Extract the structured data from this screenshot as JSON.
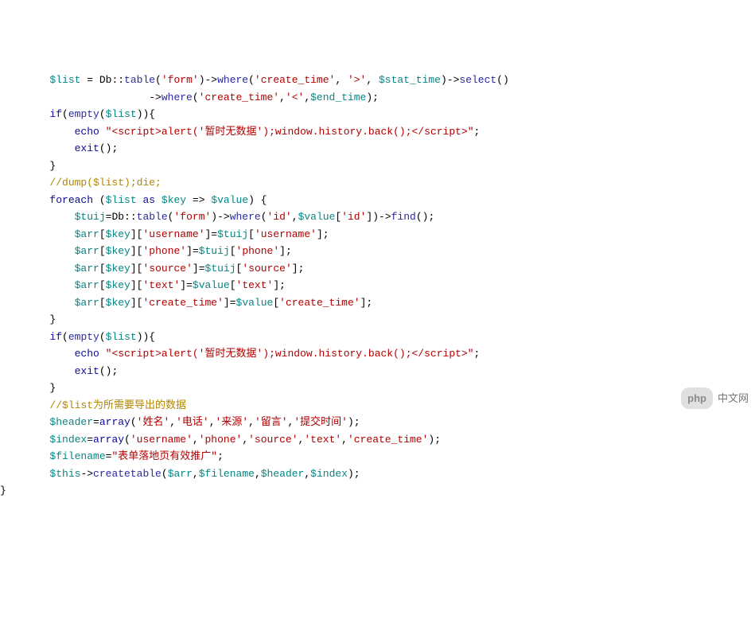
{
  "lines": [
    {
      "indent": 8,
      "tokens": [
        {
          "t": "v",
          "x": "$list"
        },
        {
          "t": "p",
          "x": " = Db::"
        },
        {
          "t": "f",
          "x": "table"
        },
        {
          "t": "p",
          "x": "("
        },
        {
          "t": "s",
          "x": "'form'"
        },
        {
          "t": "p",
          "x": ")->"
        },
        {
          "t": "f",
          "x": "where"
        },
        {
          "t": "p",
          "x": "("
        },
        {
          "t": "s",
          "x": "'create_time'"
        },
        {
          "t": "p",
          "x": ", "
        },
        {
          "t": "s",
          "x": "'>'"
        },
        {
          "t": "p",
          "x": ", "
        },
        {
          "t": "v",
          "x": "$stat_time"
        },
        {
          "t": "p",
          "x": ")->"
        },
        {
          "t": "f",
          "x": "select"
        },
        {
          "t": "p",
          "x": "()"
        }
      ]
    },
    {
      "indent": 24,
      "tokens": [
        {
          "t": "p",
          "x": "->"
        },
        {
          "t": "f",
          "x": "where"
        },
        {
          "t": "p",
          "x": "("
        },
        {
          "t": "s",
          "x": "'create_time'"
        },
        {
          "t": "p",
          "x": ","
        },
        {
          "t": "s",
          "x": "'<'"
        },
        {
          "t": "p",
          "x": ","
        },
        {
          "t": "v",
          "x": "$end_time"
        },
        {
          "t": "p",
          "x": ");"
        }
      ]
    },
    {
      "indent": 8,
      "tokens": [
        {
          "t": "k",
          "x": "if"
        },
        {
          "t": "p",
          "x": "("
        },
        {
          "t": "f",
          "x": "empty"
        },
        {
          "t": "p",
          "x": "("
        },
        {
          "t": "v",
          "x": "$list"
        },
        {
          "t": "p",
          "x": ")){"
        }
      ]
    },
    {
      "indent": 12,
      "tokens": [
        {
          "t": "k",
          "x": "echo"
        },
        {
          "t": "p",
          "x": " "
        },
        {
          "t": "s",
          "x": "\"<script>alert('暂时无数据');window.history.back();</script>\""
        },
        {
          "t": "p",
          "x": ";"
        }
      ]
    },
    {
      "indent": 12,
      "tokens": [
        {
          "t": "k",
          "x": "exit"
        },
        {
          "t": "p",
          "x": "();"
        }
      ]
    },
    {
      "indent": 8,
      "tokens": [
        {
          "t": "p",
          "x": "}"
        }
      ]
    },
    {
      "indent": 8,
      "tokens": [
        {
          "t": "c",
          "x": "//dump($list);die;"
        }
      ]
    },
    {
      "indent": 8,
      "tokens": [
        {
          "t": "k",
          "x": "foreach"
        },
        {
          "t": "p",
          "x": " ("
        },
        {
          "t": "v",
          "x": "$list"
        },
        {
          "t": "p",
          "x": " "
        },
        {
          "t": "k",
          "x": "as"
        },
        {
          "t": "p",
          "x": " "
        },
        {
          "t": "v",
          "x": "$key"
        },
        {
          "t": "p",
          "x": " => "
        },
        {
          "t": "v",
          "x": "$value"
        },
        {
          "t": "p",
          "x": ") {"
        }
      ]
    },
    {
      "indent": 12,
      "tokens": [
        {
          "t": "v",
          "x": "$tuij"
        },
        {
          "t": "p",
          "x": "=Db::"
        },
        {
          "t": "f",
          "x": "table"
        },
        {
          "t": "p",
          "x": "("
        },
        {
          "t": "s",
          "x": "'form'"
        },
        {
          "t": "p",
          "x": ")->"
        },
        {
          "t": "f",
          "x": "where"
        },
        {
          "t": "p",
          "x": "("
        },
        {
          "t": "s",
          "x": "'id'"
        },
        {
          "t": "p",
          "x": ","
        },
        {
          "t": "v",
          "x": "$value"
        },
        {
          "t": "p",
          "x": "["
        },
        {
          "t": "s",
          "x": "'id'"
        },
        {
          "t": "p",
          "x": "])->"
        },
        {
          "t": "f",
          "x": "find"
        },
        {
          "t": "p",
          "x": "();"
        }
      ]
    },
    {
      "indent": 12,
      "tokens": [
        {
          "t": "v",
          "x": "$arr"
        },
        {
          "t": "p",
          "x": "["
        },
        {
          "t": "v",
          "x": "$key"
        },
        {
          "t": "p",
          "x": "]["
        },
        {
          "t": "s",
          "x": "'username'"
        },
        {
          "t": "p",
          "x": "]="
        },
        {
          "t": "v",
          "x": "$tuij"
        },
        {
          "t": "p",
          "x": "["
        },
        {
          "t": "s",
          "x": "'username'"
        },
        {
          "t": "p",
          "x": "];"
        }
      ]
    },
    {
      "indent": 12,
      "tokens": [
        {
          "t": "v",
          "x": "$arr"
        },
        {
          "t": "p",
          "x": "["
        },
        {
          "t": "v",
          "x": "$key"
        },
        {
          "t": "p",
          "x": "]["
        },
        {
          "t": "s",
          "x": "'phone'"
        },
        {
          "t": "p",
          "x": "]="
        },
        {
          "t": "v",
          "x": "$tuij"
        },
        {
          "t": "p",
          "x": "["
        },
        {
          "t": "s",
          "x": "'phone'"
        },
        {
          "t": "p",
          "x": "];"
        }
      ]
    },
    {
      "indent": 12,
      "tokens": [
        {
          "t": "v",
          "x": "$arr"
        },
        {
          "t": "p",
          "x": "["
        },
        {
          "t": "v",
          "x": "$key"
        },
        {
          "t": "p",
          "x": "]["
        },
        {
          "t": "s",
          "x": "'source'"
        },
        {
          "t": "p",
          "x": "]="
        },
        {
          "t": "v",
          "x": "$tuij"
        },
        {
          "t": "p",
          "x": "["
        },
        {
          "t": "s",
          "x": "'source'"
        },
        {
          "t": "p",
          "x": "];"
        }
      ]
    },
    {
      "indent": 12,
      "tokens": [
        {
          "t": "v",
          "x": "$arr"
        },
        {
          "t": "p",
          "x": "["
        },
        {
          "t": "v",
          "x": "$key"
        },
        {
          "t": "p",
          "x": "]["
        },
        {
          "t": "s",
          "x": "'text'"
        },
        {
          "t": "p",
          "x": "]="
        },
        {
          "t": "v",
          "x": "$value"
        },
        {
          "t": "p",
          "x": "["
        },
        {
          "t": "s",
          "x": "'text'"
        },
        {
          "t": "p",
          "x": "];"
        }
      ]
    },
    {
      "indent": 12,
      "tokens": [
        {
          "t": "v",
          "x": "$arr"
        },
        {
          "t": "p",
          "x": "["
        },
        {
          "t": "v",
          "x": "$key"
        },
        {
          "t": "p",
          "x": "]["
        },
        {
          "t": "s",
          "x": "'create_time'"
        },
        {
          "t": "p",
          "x": "]="
        },
        {
          "t": "v",
          "x": "$value"
        },
        {
          "t": "p",
          "x": "["
        },
        {
          "t": "s",
          "x": "'create_time'"
        },
        {
          "t": "p",
          "x": "];"
        }
      ]
    },
    {
      "indent": 8,
      "tokens": [
        {
          "t": "p",
          "x": "}"
        }
      ]
    },
    {
      "indent": 8,
      "tokens": [
        {
          "t": "k",
          "x": "if"
        },
        {
          "t": "p",
          "x": "("
        },
        {
          "t": "f",
          "x": "empty"
        },
        {
          "t": "p",
          "x": "("
        },
        {
          "t": "v",
          "x": "$list"
        },
        {
          "t": "p",
          "x": ")){"
        }
      ]
    },
    {
      "indent": 12,
      "tokens": [
        {
          "t": "k",
          "x": "echo"
        },
        {
          "t": "p",
          "x": " "
        },
        {
          "t": "s",
          "x": "\"<script>alert('暂时无数据');window.history.back();</script>\""
        },
        {
          "t": "p",
          "x": ";"
        }
      ]
    },
    {
      "indent": 12,
      "tokens": [
        {
          "t": "k",
          "x": "exit"
        },
        {
          "t": "p",
          "x": "();"
        }
      ]
    },
    {
      "indent": 8,
      "tokens": [
        {
          "t": "p",
          "x": "}"
        }
      ]
    },
    {
      "indent": 8,
      "tokens": [
        {
          "t": "c",
          "x": "//$list为所需要导出的数据"
        }
      ]
    },
    {
      "indent": 8,
      "tokens": [
        {
          "t": "v",
          "x": "$header"
        },
        {
          "t": "p",
          "x": "="
        },
        {
          "t": "k",
          "x": "array"
        },
        {
          "t": "p",
          "x": "("
        },
        {
          "t": "s",
          "x": "'姓名'"
        },
        {
          "t": "p",
          "x": ","
        },
        {
          "t": "s",
          "x": "'电话'"
        },
        {
          "t": "p",
          "x": ","
        },
        {
          "t": "s",
          "x": "'来源'"
        },
        {
          "t": "p",
          "x": ","
        },
        {
          "t": "s",
          "x": "'留言'"
        },
        {
          "t": "p",
          "x": ","
        },
        {
          "t": "s",
          "x": "'提交时间'"
        },
        {
          "t": "p",
          "x": ");"
        }
      ]
    },
    {
      "indent": 8,
      "tokens": [
        {
          "t": "v",
          "x": "$index"
        },
        {
          "t": "p",
          "x": "="
        },
        {
          "t": "k",
          "x": "array"
        },
        {
          "t": "p",
          "x": "("
        },
        {
          "t": "s",
          "x": "'username'"
        },
        {
          "t": "p",
          "x": ","
        },
        {
          "t": "s",
          "x": "'phone'"
        },
        {
          "t": "p",
          "x": ","
        },
        {
          "t": "s",
          "x": "'source'"
        },
        {
          "t": "p",
          "x": ","
        },
        {
          "t": "s",
          "x": "'text'"
        },
        {
          "t": "p",
          "x": ","
        },
        {
          "t": "s",
          "x": "'create_time'"
        },
        {
          "t": "p",
          "x": ");"
        }
      ]
    },
    {
      "indent": 8,
      "tokens": [
        {
          "t": "v",
          "x": "$filename"
        },
        {
          "t": "p",
          "x": "="
        },
        {
          "t": "s",
          "x": "\"表单落地页有效推广\""
        },
        {
          "t": "p",
          "x": ";"
        }
      ]
    },
    {
      "indent": 8,
      "tokens": [
        {
          "t": "v",
          "x": "$this"
        },
        {
          "t": "p",
          "x": "->"
        },
        {
          "t": "f",
          "x": "createtable"
        },
        {
          "t": "p",
          "x": "("
        },
        {
          "t": "v",
          "x": "$arr"
        },
        {
          "t": "p",
          "x": ","
        },
        {
          "t": "v",
          "x": "$filename"
        },
        {
          "t": "p",
          "x": ","
        },
        {
          "t": "v",
          "x": "$header"
        },
        {
          "t": "p",
          "x": ","
        },
        {
          "t": "v",
          "x": "$index"
        },
        {
          "t": "p",
          "x": ");"
        }
      ]
    },
    {
      "indent": 0,
      "tokens": [
        {
          "t": "p",
          "x": "}"
        }
      ]
    }
  ],
  "logo": {
    "badge": "php",
    "text": "中文网"
  }
}
